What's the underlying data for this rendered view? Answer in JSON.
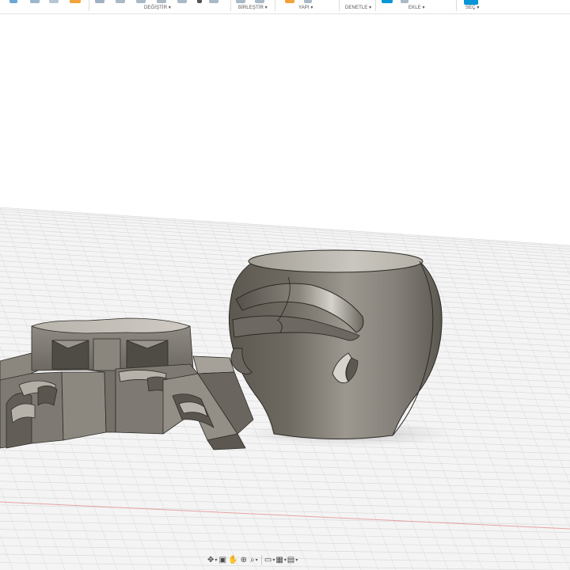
{
  "toolbar": {
    "groups": [
      {
        "id": "modify",
        "label": "DEĞİŞTİR ▾"
      },
      {
        "id": "assemble",
        "label": "BİRLEŞTİR ▾"
      },
      {
        "id": "construct",
        "label": "YAPI ▾"
      },
      {
        "id": "inspect",
        "label": "DENETLE ▾"
      },
      {
        "id": "insert",
        "label": "EKLE ▾"
      },
      {
        "id": "select",
        "label": "SEÇ ▾"
      }
    ],
    "accent_color": "#0696d7",
    "icon_color": "#f2a33a"
  },
  "viewport": {
    "background": "#ffffff",
    "grid_color": "#d0d0d0",
    "axis_color": "#e8a4a4",
    "objects": [
      {
        "name": "pot-body",
        "material": "steel"
      },
      {
        "name": "star-base",
        "material": "steel"
      }
    ]
  },
  "navbar": {
    "items": [
      {
        "id": "orbit",
        "icon": "orbit-icon",
        "glyph": "✥"
      },
      {
        "id": "look-at",
        "icon": "look-at-icon",
        "glyph": "▣"
      },
      {
        "id": "pan",
        "icon": "pan-icon",
        "glyph": "✋"
      },
      {
        "id": "zoom",
        "icon": "zoom-icon",
        "glyph": "⊕"
      },
      {
        "id": "fit",
        "icon": "fit-icon",
        "glyph": "⌕"
      },
      {
        "id": "display",
        "icon": "display-settings-icon",
        "glyph": "▭"
      },
      {
        "id": "grid",
        "icon": "grid-settings-icon",
        "glyph": "▦"
      },
      {
        "id": "viewports",
        "icon": "viewports-icon",
        "glyph": "▤"
      }
    ]
  }
}
